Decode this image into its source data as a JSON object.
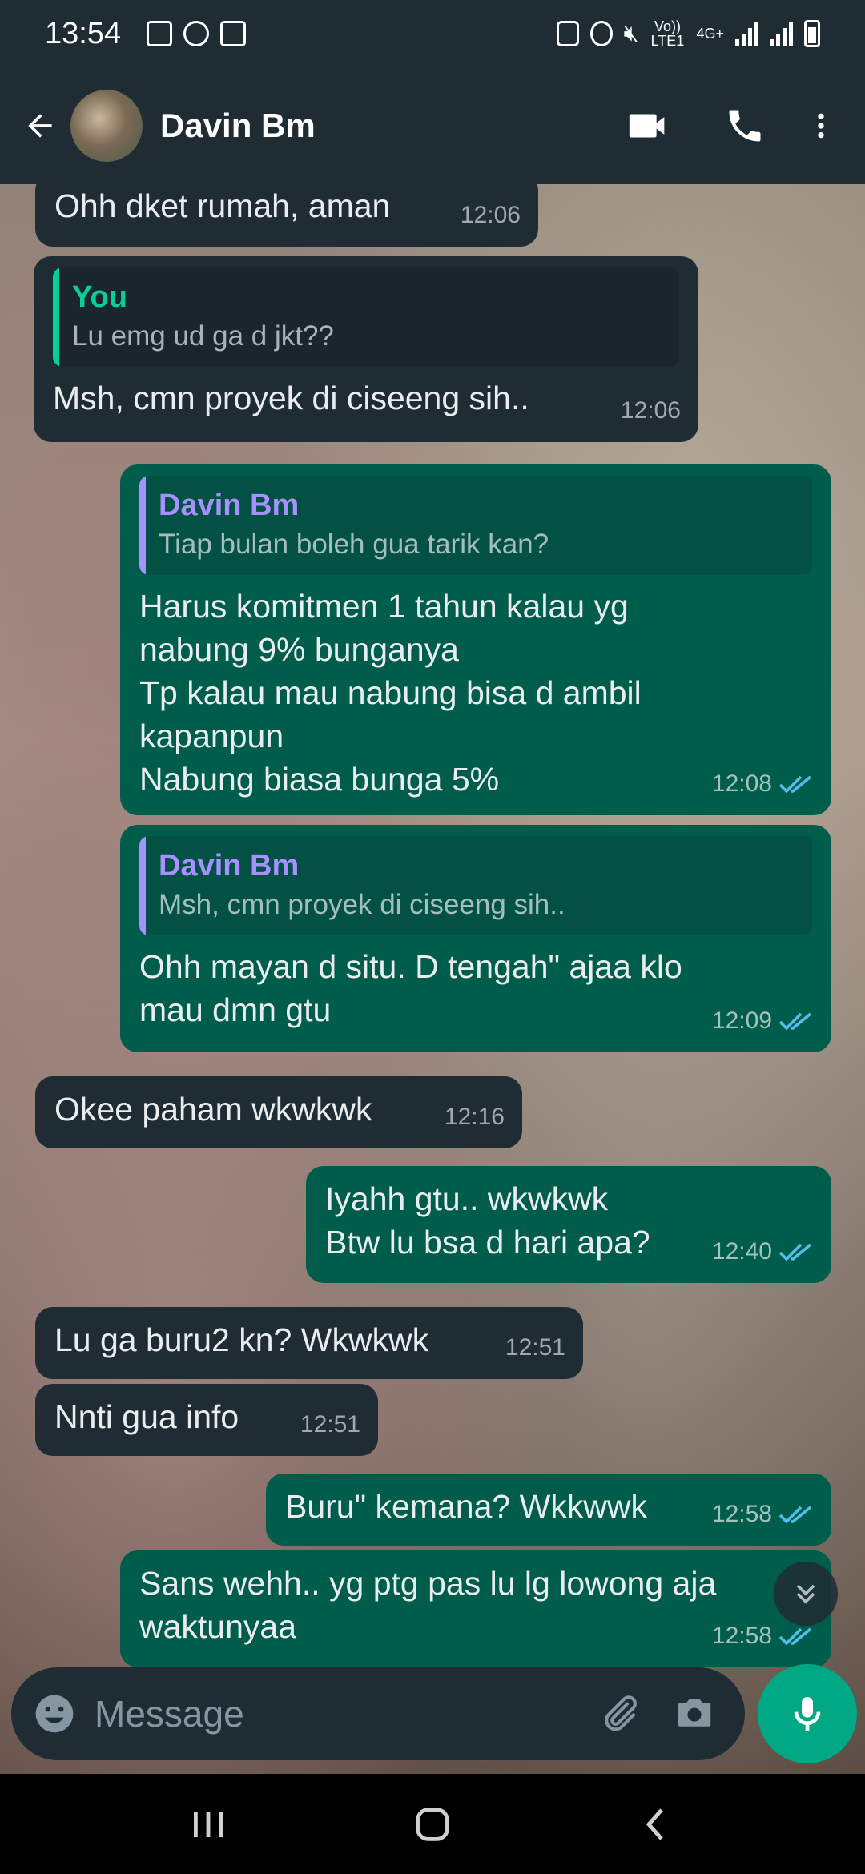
{
  "status_bar": {
    "time": "13:54",
    "network_label": "Vo)) LTE1",
    "data_label": "4G+"
  },
  "header": {
    "contact_name": "Davin Bm",
    "icons": [
      "back-arrow-icon",
      "video-call-icon",
      "voice-call-icon",
      "more-options-icon"
    ]
  },
  "messages": [
    {
      "dir": "in",
      "text": "Ohh dket rumah, aman",
      "time": "12:06"
    },
    {
      "dir": "in",
      "quote_author": "You",
      "quote_text": "Lu emg ud ga d jkt??",
      "text": "Msh, cmn proyek di ciseeng sih..",
      "time": "12:06"
    },
    {
      "dir": "out",
      "quote_author": "Davin Bm",
      "quote_text": "Tiap bulan boleh gua tarik kan?",
      "text": "Harus komitmen 1 tahun kalau yg\nnabung 9% bunganya\nTp kalau mau nabung bisa d ambil\nkapanpun\nNabung biasa bunga 5%",
      "time": "12:08",
      "status": "read"
    },
    {
      "dir": "out",
      "quote_author": "Davin Bm",
      "quote_text": "Msh, cmn proyek di ciseeng sih..",
      "text": "Ohh mayan d situ. D tengah\" ajaa klo\nmau dmn gtu",
      "time": "12:09",
      "status": "read"
    },
    {
      "dir": "in",
      "text": "Okee paham wkwkwk",
      "time": "12:16"
    },
    {
      "dir": "out",
      "text": "Iyahh gtu.. wkwkwk\nBtw lu bsa d hari apa?",
      "time": "12:40",
      "status": "read"
    },
    {
      "dir": "in",
      "text": "Lu ga buru2 kn? Wkwkwk",
      "time": "12:51"
    },
    {
      "dir": "in",
      "text": "Nnti gua info",
      "time": "12:51"
    },
    {
      "dir": "out",
      "text": "Buru\" kemana? Wkkwwk",
      "time": "12:58",
      "status": "read"
    },
    {
      "dir": "out",
      "text": "Sans wehh.. yg ptg pas lu lg lowong aja\nwaktunyaa",
      "time": "12:58",
      "status": "read"
    }
  ],
  "composer": {
    "placeholder": "Message",
    "icons": [
      "emoji-icon",
      "attach-icon",
      "camera-icon",
      "mic-icon"
    ]
  },
  "colors": {
    "header_bg": "#1f2c34",
    "incoming_bubble": "#1f2c34",
    "outgoing_bubble": "#005c4b",
    "read_ticks": "#53bdeb",
    "accent": "#00a884"
  }
}
